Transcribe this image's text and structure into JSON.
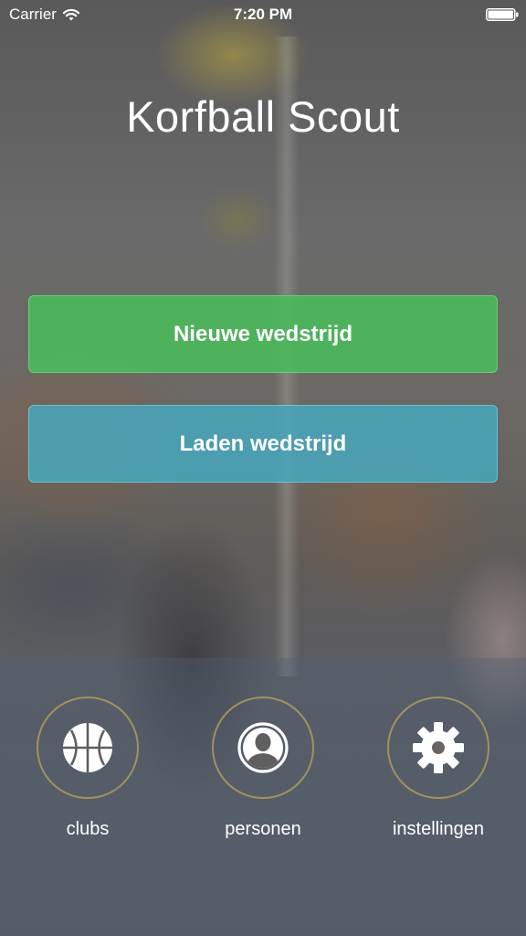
{
  "status_bar": {
    "carrier": "Carrier",
    "time": "7:20 PM"
  },
  "app": {
    "title": "Korfball Scout"
  },
  "buttons": {
    "new_match": "Nieuwe wedstrijd",
    "load_match": "Laden wedstrijd"
  },
  "nav": {
    "clubs": {
      "label": "clubs",
      "icon": "basketball-icon"
    },
    "personen": {
      "label": "personen",
      "icon": "person-icon"
    },
    "instellingen": {
      "label": "instellingen",
      "icon": "gear-icon"
    }
  },
  "colors": {
    "new_button": "#4cb85c",
    "load_button": "#48a5b9",
    "nav_ring": "#af9b5a",
    "text": "#ffffff"
  }
}
